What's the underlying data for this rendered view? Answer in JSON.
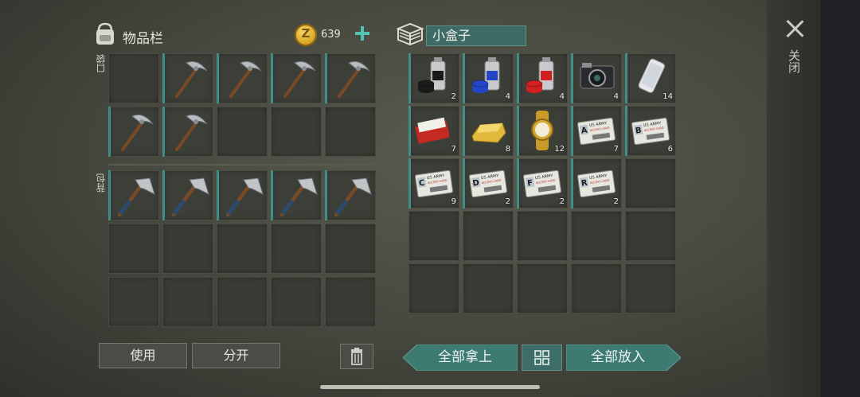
{
  "inventory": {
    "title": "物品栏",
    "pocket_label": "口袋",
    "backpack_label": "背包",
    "coin_value": "639",
    "coin_glyph": "Z"
  },
  "pocket_slots": [
    {
      "item": "empty"
    },
    {
      "item": "pickaxe",
      "progress": 0.25
    },
    {
      "item": "pickaxe",
      "progress": 0.25
    },
    {
      "item": "pickaxe",
      "progress": 0.25
    },
    {
      "item": "pickaxe",
      "progress": 0.25
    },
    {
      "item": "pickaxe",
      "progress": 1.0
    },
    {
      "item": "pickaxe",
      "progress": 1.0
    },
    {
      "item": "empty"
    },
    {
      "item": "empty"
    },
    {
      "item": "empty"
    }
  ],
  "backpack_slots": [
    {
      "item": "hatchet",
      "progress": 0.75
    },
    {
      "item": "hatchet",
      "progress": 1.0
    },
    {
      "item": "hatchet",
      "progress": 1.0
    },
    {
      "item": "hatchet",
      "progress": 1.0
    },
    {
      "item": "hatchet",
      "progress": 1.0
    },
    {
      "item": "empty"
    },
    {
      "item": "empty"
    },
    {
      "item": "empty"
    },
    {
      "item": "empty"
    },
    {
      "item": "empty"
    },
    {
      "item": "empty"
    },
    {
      "item": "empty"
    },
    {
      "item": "empty"
    },
    {
      "item": "empty"
    },
    {
      "item": "empty"
    }
  ],
  "container": {
    "title": "小盒子"
  },
  "container_slots": [
    {
      "item": "spray-black",
      "qty": "2"
    },
    {
      "item": "spray-blue",
      "qty": "4"
    },
    {
      "item": "spray-red",
      "qty": "4"
    },
    {
      "item": "camera",
      "qty": "4"
    },
    {
      "item": "phone",
      "qty": "14"
    },
    {
      "item": "cigarettes",
      "qty": "7"
    },
    {
      "item": "gold-bar",
      "qty": "8"
    },
    {
      "item": "gold-watch",
      "qty": "12"
    },
    {
      "item": "id-card",
      "letter": "A",
      "qty": "7"
    },
    {
      "item": "id-card",
      "letter": "B",
      "qty": "6"
    },
    {
      "item": "id-card",
      "letter": "C",
      "qty": "9"
    },
    {
      "item": "id-card",
      "letter": "D",
      "qty": "2"
    },
    {
      "item": "id-card",
      "letter": "F",
      "qty": "2"
    },
    {
      "item": "id-card",
      "letter": "R",
      "qty": "2"
    },
    {
      "item": "empty"
    }
  ],
  "card_text": {
    "header": "US ARMY",
    "sub": "ACCESS CARD"
  },
  "buttons": {
    "use": "使用",
    "split": "分开",
    "take_all": "全部拿上",
    "put_all": "全部放入",
    "close": "关闭"
  },
  "colors": {
    "accent": "#3d7a72",
    "coin": "#d8a727",
    "plus": "#4fc4b5"
  }
}
